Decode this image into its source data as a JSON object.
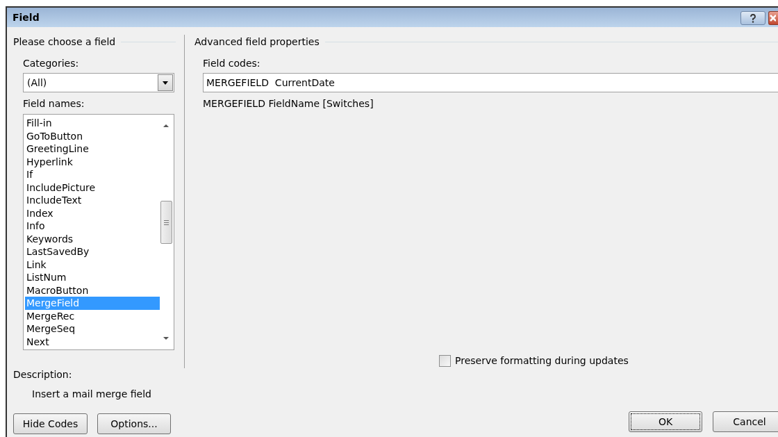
{
  "window": {
    "title": "Field"
  },
  "left": {
    "heading": "Please choose a field",
    "categories_label": "Categories:",
    "categories_value": "(All)",
    "field_names_label": "Field names:",
    "field_names": [
      {
        "label": "Fill-in",
        "selected": false
      },
      {
        "label": "GoToButton",
        "selected": false
      },
      {
        "label": "GreetingLine",
        "selected": false
      },
      {
        "label": "Hyperlink",
        "selected": false
      },
      {
        "label": "If",
        "selected": false
      },
      {
        "label": "IncludePicture",
        "selected": false
      },
      {
        "label": "IncludeText",
        "selected": false
      },
      {
        "label": "Index",
        "selected": false
      },
      {
        "label": "Info",
        "selected": false
      },
      {
        "label": "Keywords",
        "selected": false
      },
      {
        "label": "LastSavedBy",
        "selected": false
      },
      {
        "label": "Link",
        "selected": false
      },
      {
        "label": "ListNum",
        "selected": false
      },
      {
        "label": "MacroButton",
        "selected": false
      },
      {
        "label": "MergeField",
        "selected": true
      },
      {
        "label": "MergeRec",
        "selected": false
      },
      {
        "label": "MergeSeq",
        "selected": false
      },
      {
        "label": "Next",
        "selected": false
      }
    ],
    "description_label": "Description:",
    "description": "Insert a mail merge field"
  },
  "right": {
    "heading": "Advanced field properties",
    "field_codes_label": "Field codes:",
    "field_codes_value": "MERGEFIELD  CurrentDate",
    "syntax": "MERGEFIELD FieldName [Switches]",
    "preserve": {
      "label": "Preserve formatting during updates",
      "checked": false
    }
  },
  "buttons": {
    "left": [
      "Hide Codes",
      "Options..."
    ],
    "ok": "OK",
    "cancel": "Cancel"
  }
}
